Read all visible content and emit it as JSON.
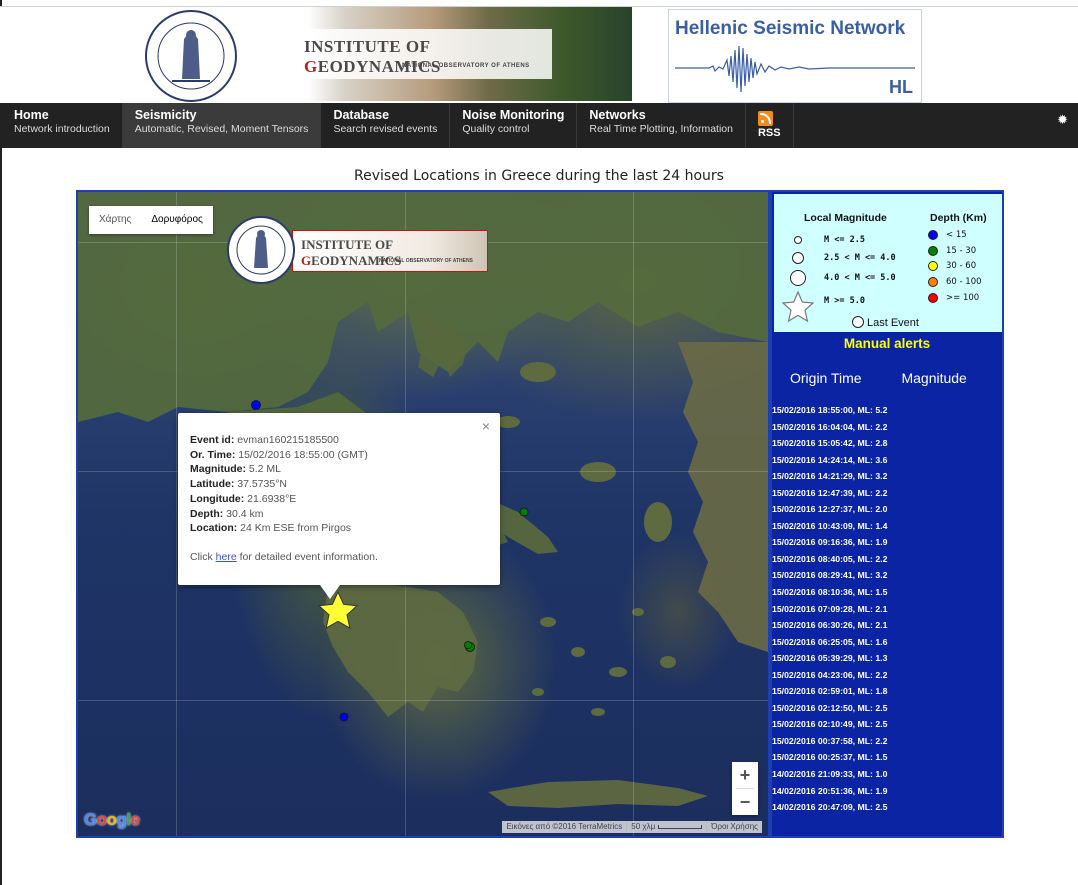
{
  "header": {
    "institute_title_first": "I",
    "institute_title_rest": "NSTITUTE OF ",
    "institute_title_g": "G",
    "institute_title_end": "EODYNAMICS",
    "institute_subtitle": "NATIONAL OBSERVATORY OF ATHENS",
    "network_title": "Hellenic Seismic Network",
    "network_code": "HL"
  },
  "nav": [
    {
      "main": "Home",
      "sub": "Network introduction"
    },
    {
      "main": "Seismicity",
      "sub": "Automatic, Revised, Moment Tensors"
    },
    {
      "main": "Database",
      "sub": "Search revised events"
    },
    {
      "main": "Noise Monitoring",
      "sub": "Quality control"
    },
    {
      "main": "Networks",
      "sub": "Real Time Plotting, Information"
    }
  ],
  "rss_label": "RSS",
  "page_title": "Revised Locations in Greece during the last 24 hours",
  "map": {
    "type_map": "Χάρτης",
    "type_satellite": "Δορυφόρος",
    "google": [
      "G",
      "o",
      "o",
      "g",
      "l",
      "e"
    ],
    "attribution_imagery": "Εικόνες από ©2016 TerraMetrics",
    "attribution_scale": "50 χλμ",
    "attribution_terms": "Όροι Χρήσης",
    "zoom_in": "+",
    "zoom_out": "−"
  },
  "popup": {
    "event_id_label": "Event id:",
    "event_id": "evman160215185500",
    "time_label": "Or. Time:",
    "time": "15/02/2016  18:55:00 (GMT)",
    "magnitude_label": "Magnitude:",
    "magnitude": "5.2 ML",
    "latitude_label": "Latitude:",
    "latitude": "37.5735°N",
    "longitude_label": "Longitude:",
    "longitude": "21.6938°E",
    "depth_label": "Depth:",
    "depth": "30.4 km",
    "location_label": "Location:",
    "location": "24 Km ESE from Pirgos",
    "click_pre": "Click ",
    "click_link": "here",
    "click_post": " for detailed event information.",
    "close": "×"
  },
  "legend": {
    "magnitude_title": "Local Magnitude",
    "depth_title": "Depth (Km)",
    "magnitudes": [
      "M <= 2.5",
      "2.5 < M <= 4.0",
      "4.0 < M <= 5.0",
      "M >= 5.0"
    ],
    "depths": [
      {
        "label": "< 15",
        "color": "#0000ff"
      },
      {
        "label": "15 - 30",
        "color": "#008000"
      },
      {
        "label": "30 - 60",
        "color": "#ffff00"
      },
      {
        "label": "60 - 100",
        "color": "#ff7f00"
      },
      {
        "label": ">= 100",
        "color": "#ff0000"
      }
    ],
    "last_event": "Last Event"
  },
  "manual_alerts": "Manual alerts",
  "columns": {
    "origin_time": "Origin Time",
    "magnitude": "Magnitude"
  },
  "events": [
    "15/02/2016  18:55:00,  ML: 5.2",
    "15/02/2016  16:04:04,  ML: 2.2",
    "15/02/2016  15:05:42,  ML: 2.8",
    "15/02/2016  14:24:14,  ML: 3.6",
    "15/02/2016  14:21:29,  ML: 3.2",
    "15/02/2016  12:47:39,  ML: 2.2",
    "15/02/2016  12:27:37,  ML: 2.0",
    "15/02/2016  10:43:09,  ML: 1.4",
    "15/02/2016  09:16:36,  ML: 1.9",
    "15/02/2016  08:40:05,  ML: 2.2",
    "15/02/2016  08:29:41,  ML: 3.2",
    "15/02/2016  08:10:36,  ML: 1.5",
    "15/02/2016  07:09:28,  ML: 2.1",
    "15/02/2016  06:30:26,  ML: 2.1",
    "15/02/2016  06:25:05,  ML: 1.6",
    "15/02/2016  05:39:29,  ML: 1.3",
    "15/02/2016  04:23:06,  ML: 2.2",
    "15/02/2016  02:59:01,  ML: 1.8",
    "15/02/2016  02:12:50,  ML: 2.5",
    "15/02/2016  02:10:49,  ML: 2.5",
    "15/02/2016  00:37:58,  ML: 2.2",
    "15/02/2016  00:25:37,  ML: 1.5",
    "14/02/2016  21:09:33,  ML: 1.0",
    "14/02/2016  20:51:36,  ML: 1.9",
    "14/02/2016  20:47:09,  ML: 2.5"
  ],
  "colors": {
    "panel_bg": "#0a24a4",
    "legend_bg": "#cfffff",
    "alert_yellow": "#ffff00",
    "nav_bg": "#222222",
    "star_fill": "#ffff33"
  }
}
